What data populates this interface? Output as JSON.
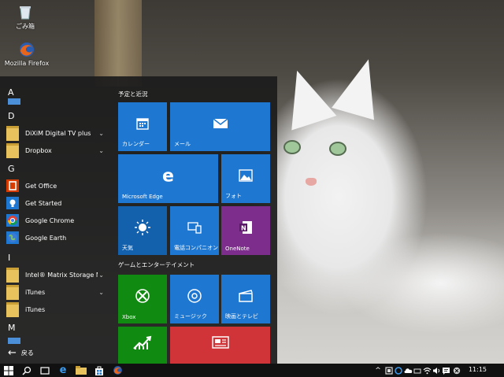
{
  "desktop": {
    "icons": [
      {
        "label": "ごみ箱",
        "icon": "recycle-bin-icon"
      },
      {
        "label": "Mozilla Firefox",
        "icon": "firefox-icon"
      }
    ]
  },
  "start_menu": {
    "sections": [
      "A",
      "D",
      "G",
      "I",
      "M"
    ],
    "apps": [
      {
        "label": "DiXiM Digital TV plus",
        "icon": "folder-icon",
        "expandable": true
      },
      {
        "label": "Dropbox",
        "icon": "folder-icon",
        "expandable": true
      },
      {
        "label": "Get Office",
        "icon": "office-icon",
        "expandable": false
      },
      {
        "label": "Get Started",
        "icon": "lightbulb-icon",
        "expandable": false
      },
      {
        "label": "Google Chrome",
        "icon": "chrome-icon",
        "expandable": false
      },
      {
        "label": "Google Earth",
        "icon": "earth-icon",
        "expandable": false
      },
      {
        "label": "Intel® Matrix Storage M...",
        "icon": "folder-icon",
        "expandable": true
      },
      {
        "label": "iTunes",
        "icon": "folder-icon",
        "expandable": true
      },
      {
        "label": "iTunes",
        "icon": "folder-icon",
        "expandable": false
      }
    ],
    "back_label": "戻る",
    "groups": [
      {
        "title": "予定と近況"
      },
      {
        "title": "ゲームとエンターテイメント"
      }
    ],
    "tiles": [
      {
        "label": "カレンダー",
        "icon": "calendar-icon",
        "color": "#1e78d2"
      },
      {
        "label": "メール",
        "icon": "mail-icon",
        "color": "#1e78d2"
      },
      {
        "label": "Microsoft Edge",
        "icon": "edge-icon",
        "color": "#1e78d2"
      },
      {
        "label": "フォト",
        "icon": "photos-icon",
        "color": "#1e78d2"
      },
      {
        "label": "天気",
        "icon": "weather-icon",
        "color": "#1360ad"
      },
      {
        "label": "電話コンパニオン",
        "icon": "phone-companion-icon",
        "color": "#1e78d2"
      },
      {
        "label": "OneNote",
        "icon": "onenote-icon",
        "color": "#7d2d8b"
      },
      {
        "label": "Xbox",
        "icon": "xbox-icon",
        "color": "#118a11"
      },
      {
        "label": "ミュージック",
        "icon": "music-icon",
        "color": "#1e78d2"
      },
      {
        "label": "映画とテレビ",
        "icon": "movies-icon",
        "color": "#1e78d2"
      },
      {
        "label": "",
        "icon": "money-icon",
        "color": "#118a11"
      },
      {
        "label": "",
        "icon": "news-icon",
        "color": "#d13438"
      }
    ]
  },
  "taskbar": {
    "items": [
      "windows-start-icon",
      "search-icon",
      "task-view-icon",
      "edge-icon",
      "file-explorer-icon",
      "store-icon",
      "firefox-icon"
    ],
    "tray": [
      "show-hidden-icon",
      "tray-app-icon-1",
      "tray-app-icon-2",
      "onedrive-icon",
      "tray-app-icon-3",
      "network-icon",
      "volume-icon",
      "ime-icon",
      "action-center-icon",
      "close-circle-icon"
    ],
    "clock": "11:15"
  }
}
